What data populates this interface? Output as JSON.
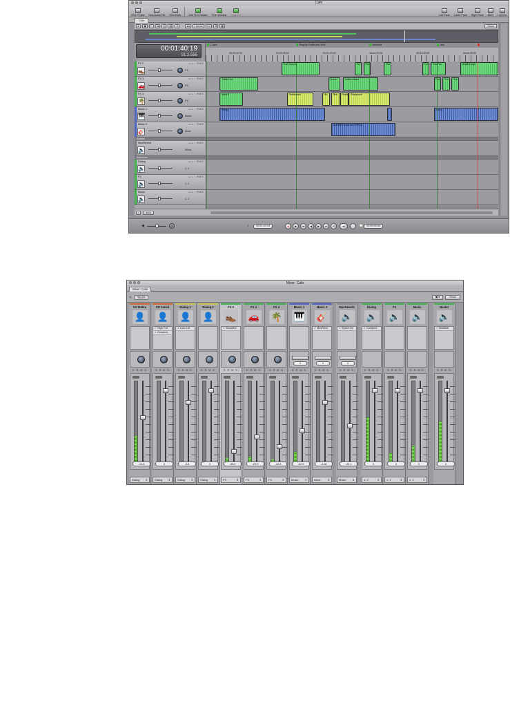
{
  "main_window": {
    "title": "Cafe",
    "toolbar": [
      "New Project",
      "New Audio File",
      "New Track",
      "Add Time Marker",
      "Fit in Window",
      "Snapshot"
    ],
    "toolbar_right": [
      "Left Pane",
      "Lower Pane",
      "Right Pane",
      "Mixer",
      "Layouts"
    ],
    "tab": "Cafe",
    "show_label": "Show",
    "items_label": "1 Items",
    "zoom_value": "0.0",
    "timecode": "00:01:40:19",
    "timecode_sub": "51.2.555",
    "markers": [
      {
        "label": "1 Jazz",
        "x": 0.005
      },
      {
        "label": "Regular Radio and Well",
        "x": 0.31
      },
      {
        "label": "Interlude",
        "x": 0.56
      },
      {
        "label": "Jazz",
        "x": 0.79
      },
      {
        "label": "",
        "x": 0.93,
        "red": true
      }
    ],
    "ruler_times": [
      "00:00:20:00",
      "00:00:40:00",
      "00:01:00:00",
      "00:01:20:00",
      "00:01:40:00",
      "00:02:00:00"
    ],
    "tracks": [
      {
        "name": "FX 2",
        "bus": "FX",
        "color": "#3cb44b",
        "icon": "shoe-icon",
        "glyph": "👞"
      },
      {
        "name": "FX 3",
        "bus": "FX",
        "color": "#3cb44b",
        "icon": "car-icon",
        "glyph": "🚗"
      },
      {
        "name": "FX 4",
        "bus": "FX",
        "color": "#3cb44b",
        "icon": "tree-icon",
        "glyph": "🌴"
      },
      {
        "name": "Music 1",
        "bus": "Music",
        "color": "#4a64c8",
        "icon": "keyboard-icon",
        "glyph": "🎹"
      },
      {
        "name": "Music 2",
        "bus": "None",
        "color": "#4a64c8",
        "icon": "guitar-icon",
        "glyph": "🎸"
      }
    ],
    "busses_label": "Busses",
    "busses": [
      {
        "name": "MusReverb",
        "bus": "Music"
      }
    ],
    "submixes_label": "Submixes",
    "submixes": [
      {
        "name": "Dialog",
        "bus": "1, 2"
      },
      {
        "name": "FX",
        "bus": "1, 2"
      },
      {
        "name": "Music",
        "bus": "1, 2"
      }
    ],
    "clips": [
      {
        "lane": 0,
        "type": "g",
        "label": "Foot Sounds",
        "x": 0.26,
        "w": 0.13
      },
      {
        "lane": 0,
        "type": "g",
        "label": "Foo",
        "x": 0.51,
        "w": 0.025
      },
      {
        "lane": 0,
        "type": "g",
        "label": "Foo",
        "x": 0.54,
        "w": 0.025
      },
      {
        "lane": 0,
        "type": "g",
        "label": "Foo",
        "x": 0.61,
        "w": 0.025
      },
      {
        "lane": 0,
        "type": "g",
        "label": "Foo",
        "x": 0.74,
        "w": 0.025
      },
      {
        "lane": 0,
        "type": "g",
        "label": "Foo Foo",
        "x": 0.77,
        "w": 0.05
      },
      {
        "lane": 0,
        "type": "g",
        "label": "Walkthrough",
        "x": 0.87,
        "w": 0.13
      },
      {
        "lane": 1,
        "type": "g",
        "label": "Traffic Car",
        "x": 0.05,
        "w": 0.13
      },
      {
        "lane": 1,
        "type": "g",
        "label": "Doors",
        "x": 0.42,
        "w": 0.04
      },
      {
        "lane": 1,
        "type": "g",
        "label": "Coffee Maker",
        "x": 0.47,
        "w": 0.12
      },
      {
        "lane": 1,
        "type": "g",
        "label": "Foo",
        "x": 0.78,
        "w": 0.025
      },
      {
        "lane": 1,
        "type": "g",
        "label": "Foo",
        "x": 0.81,
        "w": 0.025
      },
      {
        "lane": 1,
        "type": "g",
        "label": "Foo",
        "x": 0.84,
        "w": 0.025
      },
      {
        "lane": 2,
        "type": "g",
        "label": "Wind S",
        "x": 0.05,
        "w": 0.08
      },
      {
        "lane": 2,
        "type": "y",
        "label": "Restaurant",
        "x": 0.28,
        "w": 0.09
      },
      {
        "lane": 2,
        "type": "y",
        "label": "Re",
        "x": 0.4,
        "w": 0.025
      },
      {
        "lane": 2,
        "type": "y",
        "label": "Res",
        "x": 0.43,
        "w": 0.03
      },
      {
        "lane": 2,
        "type": "y",
        "label": "Resta",
        "x": 0.46,
        "w": 0.03
      },
      {
        "lane": 2,
        "type": "y",
        "label": "Restaurant",
        "x": 0.49,
        "w": 0.14
      },
      {
        "lane": 3,
        "type": "b",
        "label": "Swing",
        "x": 0.05,
        "w": 0.36
      },
      {
        "lane": 3,
        "type": "b",
        "label": "",
        "x": 0.62,
        "w": 0.018
      },
      {
        "lane": 3,
        "type": "b",
        "label": "Swing",
        "x": 0.78,
        "w": 0.22
      },
      {
        "lane": 4,
        "type": "b",
        "label": "Acoustic Guitar Jazz Left 03",
        "x": 0.43,
        "w": 0.22
      }
    ],
    "transport_tc_left": "00:01:40:19",
    "transport_tc_right": "00:00:00:00",
    "zoom_select": "area"
  },
  "mixer": {
    "title": "Mixer: Cafe",
    "tab": "Mixer: Cafe",
    "touch_label": "Touch",
    "show_label": "Show",
    "strips": [
      {
        "name": "VO Debra",
        "color": "#d06a2c",
        "glyph": "👤",
        "icon": "person-icon",
        "fx": [],
        "kind": "knob",
        "meter": 0.32,
        "fader": 0.55,
        "vol": "-14.6",
        "out": "Dialog"
      },
      {
        "name": "VO Jacob",
        "color": "#d06a2c",
        "glyph": "👤",
        "icon": "person-icon",
        "fx": [
          "High Cut",
          "Compres"
        ],
        "kind": "knob",
        "meter": 0,
        "fader": 0.9,
        "vol": "0",
        "out": "Dialog"
      },
      {
        "name": "Dialog 1",
        "color": "#c8c44a",
        "glyph": "👤",
        "icon": "person-icon",
        "fx": [
          "Low Cut"
        ],
        "kind": "knob",
        "meter": 0,
        "fader": 0.75,
        "vol": "-4.8",
        "out": "Dialog"
      },
      {
        "name": "Dialog 2",
        "color": "#c8c44a",
        "glyph": "👤",
        "icon": "person-icon",
        "fx": [],
        "kind": "knob",
        "meter": 0,
        "fader": 0.9,
        "vol": "0",
        "out": "Dialog"
      },
      {
        "name": "FX 2",
        "color": "#3cb44b",
        "glyph": "👞",
        "icon": "shoe-icon",
        "fx": [
          "Soundtra"
        ],
        "kind": "knob",
        "meter": 0.04,
        "fader": 0.12,
        "vol": "-35.0",
        "out": "FX",
        "sel": true
      },
      {
        "name": "FX 3",
        "color": "#3cb44b",
        "glyph": "🚗",
        "icon": "car-icon",
        "fx": [],
        "kind": "knob",
        "meter": 0.06,
        "fader": 0.3,
        "vol": "-29.9",
        "out": "FX"
      },
      {
        "name": "FX 4",
        "color": "#3cb44b",
        "glyph": "🌴",
        "icon": "tree-icon",
        "fx": [],
        "kind": "knob",
        "meter": 0.03,
        "fader": 0.18,
        "vol": "-44.8",
        "out": "FX"
      },
      {
        "name": "Music 1",
        "color": "#4a64c8",
        "glyph": "🎹",
        "icon": "keyboard-icon",
        "fx": [],
        "kind": "bal",
        "bal": "0",
        "meter": 0.12,
        "fader": 0.38,
        "vol": "-22.9",
        "out": "Music"
      },
      {
        "name": "Music 2",
        "color": "#4a64c8",
        "glyph": "🎸",
        "icon": "guitar-icon",
        "fx": [
          "MusReve"
        ],
        "kind": "bal",
        "bal": "0",
        "meter": 0,
        "fader": 0.75,
        "vol": "-4.48",
        "out": "None"
      },
      {
        "name": "MusReverb",
        "color": "#8a8a90",
        "glyph": "🔈",
        "icon": "speaker-icon",
        "fx": [
          "Space De"
        ],
        "kind": "bal",
        "bal": "0",
        "meter": 0,
        "fader": 0.45,
        "vol": "-22.1",
        "out": "Music"
      },
      {
        "name": "Dialog",
        "color": "#3cb44b",
        "glyph": "🔈",
        "icon": "speaker-icon",
        "fx": [
          "Compres"
        ],
        "kind": "none",
        "meter": 0.55,
        "fader": 0.9,
        "vol": "0",
        "out": "1, 2"
      },
      {
        "name": "FX",
        "color": "#3cb44b",
        "glyph": "🔈",
        "icon": "speaker-icon",
        "fx": [],
        "kind": "none",
        "meter": 0.1,
        "fader": 0.9,
        "vol": "0",
        "out": "1, 2"
      },
      {
        "name": "Music",
        "color": "#3cb44b",
        "glyph": "🔈",
        "icon": "speaker-icon",
        "fx": [],
        "kind": "none",
        "meter": 0.2,
        "fader": 0.9,
        "vol": "0",
        "out": "1, 2"
      },
      {
        "name": "Master",
        "color": "#3cb44b",
        "glyph": "🔈",
        "icon": "speaker-icon",
        "fx": [
          "MultiMet"
        ],
        "kind": "none",
        "meter": 0.5,
        "fader": 0.9,
        "vol": "0",
        "out": ""
      }
    ],
    "strip_buttons": "E R M S"
  }
}
